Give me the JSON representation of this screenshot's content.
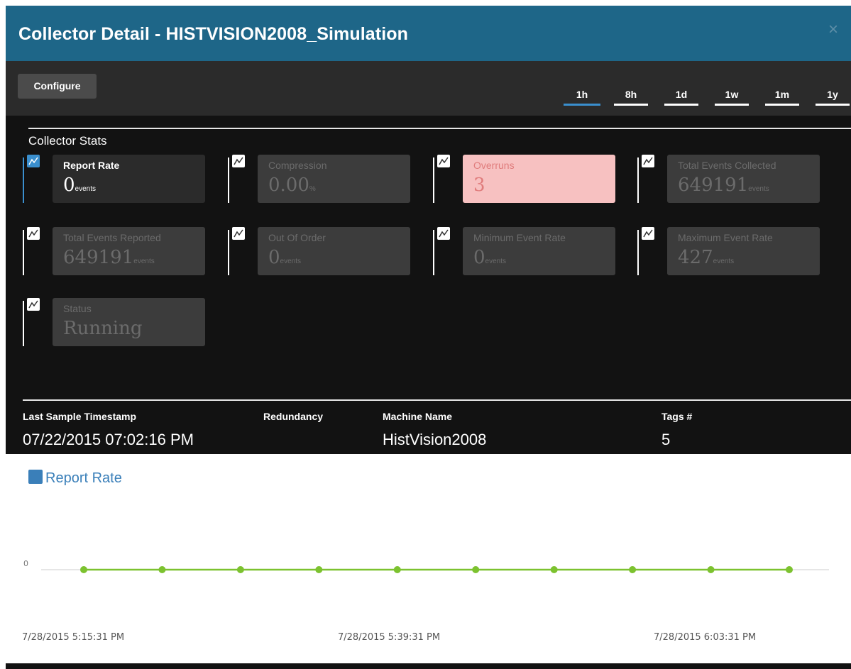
{
  "window": {
    "title": "Collector Detail - HISTVISION2008_Simulation",
    "close_glyph": "×"
  },
  "toolbar": {
    "configure_label": "Configure",
    "ranges": [
      "1h",
      "8h",
      "1d",
      "1w",
      "1m",
      "1y"
    ],
    "active_range": "1h"
  },
  "stats": {
    "section_title": "Collector Stats",
    "cards": [
      {
        "label": "Report Rate",
        "value": "0",
        "unit": "events",
        "state": "active",
        "icon": "chart-icon"
      },
      {
        "label": "Compression",
        "value": "0.00",
        "unit": "%",
        "state": "disabled",
        "icon": "chart-icon"
      },
      {
        "label": "Overruns",
        "value": "3",
        "unit": "",
        "state": "alert",
        "icon": "chart-icon"
      },
      {
        "label": "Total Events Collected",
        "value": "649191",
        "unit": "events",
        "state": "disabled",
        "icon": "chart-icon"
      },
      {
        "label": "Total Events Reported",
        "value": "649191",
        "unit": "events",
        "state": "disabled",
        "icon": "chart-icon"
      },
      {
        "label": "Out Of Order",
        "value": "0",
        "unit": "events",
        "state": "disabled",
        "icon": "chart-icon"
      },
      {
        "label": "Minimum Event Rate",
        "value": "0",
        "unit": "events",
        "state": "disabled",
        "icon": "chart-icon"
      },
      {
        "label": "Maximum Event Rate",
        "value": "427",
        "unit": "events",
        "state": "disabled",
        "icon": "chart-icon"
      },
      {
        "label": "Status",
        "value": "Running",
        "unit": "",
        "state": "disabled",
        "icon": "chart-icon"
      }
    ]
  },
  "info": {
    "last_sample_label": "Last Sample Timestamp",
    "last_sample_value": "07/22/2015 07:02:16 PM",
    "redundancy_label": "Redundancy",
    "redundancy_value": "",
    "machine_label": "Machine Name",
    "machine_value": "HistVision2008",
    "tags_label": "Tags #",
    "tags_value": "5"
  },
  "chart_data": {
    "type": "line",
    "title": "Report Rate",
    "x_tick_labels": [
      "7/28/2015 5:15:31 PM",
      "7/28/2015 5:39:31 PM",
      "7/28/2015 6:03:31 PM"
    ],
    "y_tick_labels": [
      "0"
    ],
    "series": [
      {
        "color": "#7cc22f",
        "values": [
          0,
          0,
          0,
          0,
          0,
          0,
          0,
          0,
          0,
          0
        ]
      }
    ],
    "grid": false,
    "legend": "none"
  },
  "colors": {
    "title_bar": "#1e6688",
    "active_tab": "#3a8fce",
    "alert_card": "#f7c1c1",
    "series_line": "#7cc22f"
  }
}
